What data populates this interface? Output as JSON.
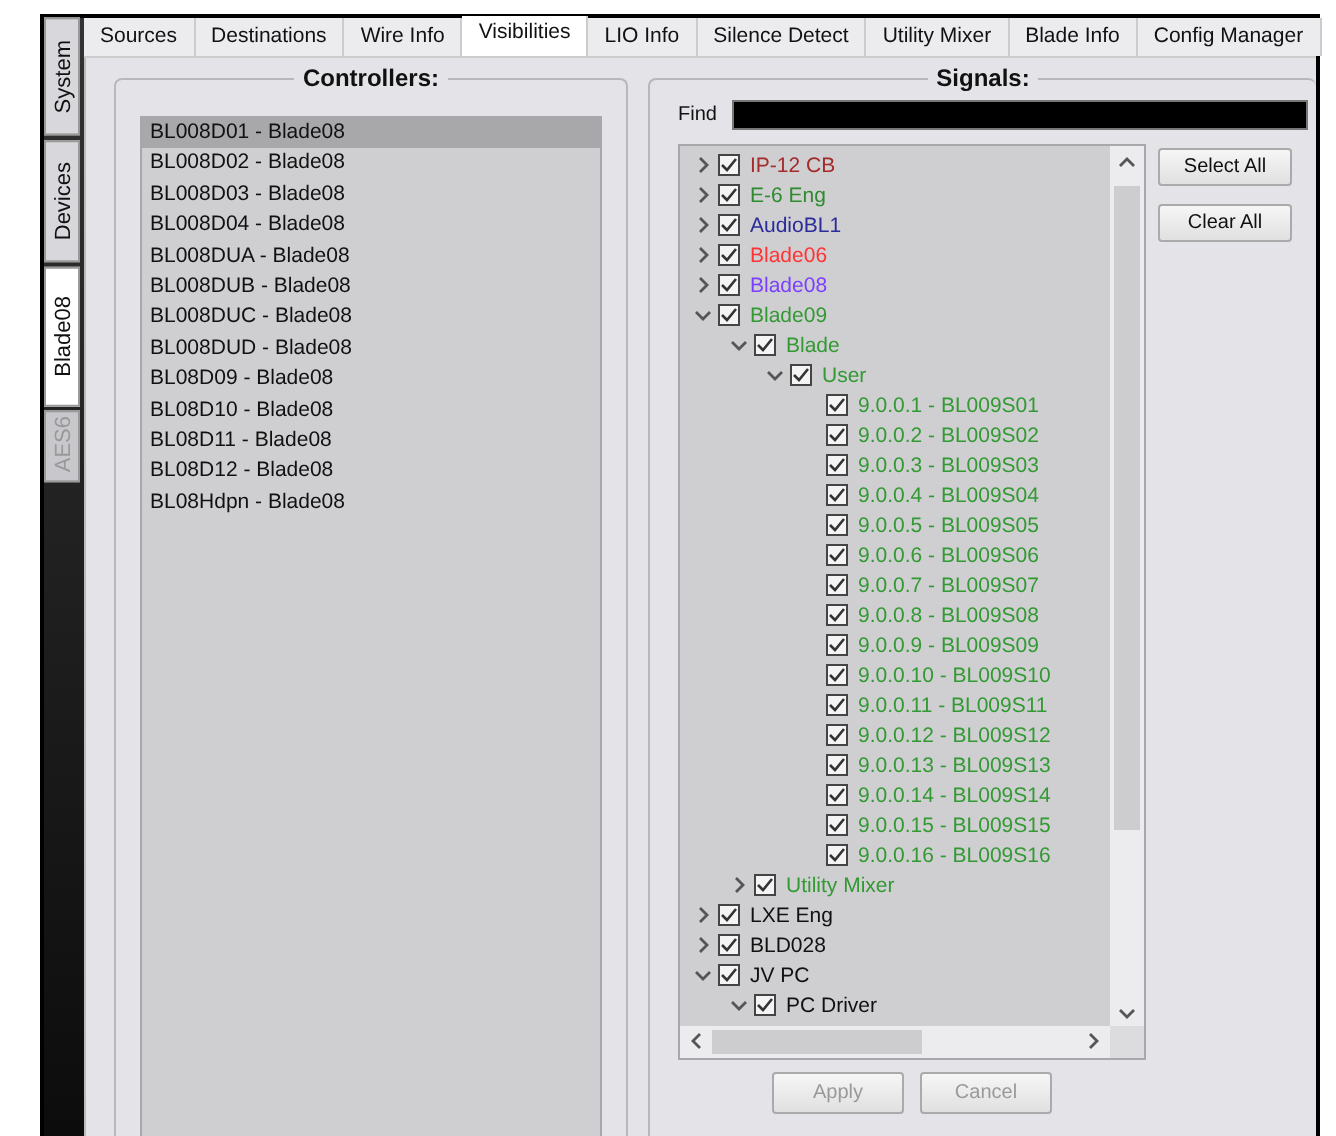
{
  "side_tabs": [
    {
      "label": "System",
      "selected": false,
      "disabled": false
    },
    {
      "label": "Devices",
      "selected": false,
      "disabled": false
    },
    {
      "label": "Blade08",
      "selected": true,
      "disabled": false
    },
    {
      "label": "AES6",
      "selected": false,
      "disabled": true
    }
  ],
  "tabs": [
    {
      "label": "Sources",
      "selected": false
    },
    {
      "label": "Destinations",
      "selected": false
    },
    {
      "label": "Wire Info",
      "selected": false
    },
    {
      "label": "Visibilities",
      "selected": true
    },
    {
      "label": "LIO Info",
      "selected": false
    },
    {
      "label": "Silence Detect",
      "selected": false
    },
    {
      "label": "Utility Mixer",
      "selected": false
    },
    {
      "label": "Blade Info",
      "selected": false
    },
    {
      "label": "Config Manager",
      "selected": false
    }
  ],
  "controllers": {
    "title": "Controllers:",
    "items": [
      {
        "label": "BL008D01 - Blade08",
        "selected": true
      },
      {
        "label": "BL008D02 - Blade08",
        "selected": false
      },
      {
        "label": "BL008D03 - Blade08",
        "selected": false
      },
      {
        "label": "BL008D04 - Blade08",
        "selected": false
      },
      {
        "label": "BL008DUA - Blade08",
        "selected": false
      },
      {
        "label": "BL008DUB - Blade08",
        "selected": false
      },
      {
        "label": "BL008DUC - Blade08",
        "selected": false
      },
      {
        "label": "BL008DUD - Blade08",
        "selected": false
      },
      {
        "label": "BL08D09 - Blade08",
        "selected": false
      },
      {
        "label": "BL08D10 - Blade08",
        "selected": false
      },
      {
        "label": "BL08D11 - Blade08",
        "selected": false
      },
      {
        "label": "BL08D12 - Blade08",
        "selected": false
      },
      {
        "label": "BL08Hdpn - Blade08",
        "selected": false
      }
    ]
  },
  "signals": {
    "title": "Signals:",
    "find_label": "Find",
    "tree": [
      {
        "label": "IP-12 CB",
        "checked": true,
        "expanded": false,
        "color": "#a52a2a"
      },
      {
        "label": "E-6 Eng",
        "checked": true,
        "expanded": false,
        "color": "#2e8b2e"
      },
      {
        "label": "AudioBL1",
        "checked": true,
        "expanded": false,
        "color": "#2a2a99"
      },
      {
        "label": "Blade06",
        "checked": true,
        "expanded": false,
        "color": "#ff3333"
      },
      {
        "label": "Blade08",
        "checked": true,
        "expanded": false,
        "color": "#7b3fff"
      },
      {
        "label": "Blade09",
        "checked": true,
        "expanded": true,
        "color": "#339933",
        "children": [
          {
            "label": "Blade",
            "checked": true,
            "expanded": true,
            "color": "#339933",
            "children": [
              {
                "label": "User",
                "checked": true,
                "expanded": true,
                "color": "#339933",
                "children": [
                  {
                    "label": "9.0.0.1 - BL009S01",
                    "checked": true,
                    "color": "#339933"
                  },
                  {
                    "label": "9.0.0.2 - BL009S02",
                    "checked": true,
                    "color": "#339933"
                  },
                  {
                    "label": "9.0.0.3 - BL009S03",
                    "checked": true,
                    "color": "#339933"
                  },
                  {
                    "label": "9.0.0.4 - BL009S04",
                    "checked": true,
                    "color": "#339933"
                  },
                  {
                    "label": "9.0.0.5 - BL009S05",
                    "checked": true,
                    "color": "#339933"
                  },
                  {
                    "label": "9.0.0.6 - BL009S06",
                    "checked": true,
                    "color": "#339933"
                  },
                  {
                    "label": "9.0.0.7 - BL009S07",
                    "checked": true,
                    "color": "#339933"
                  },
                  {
                    "label": "9.0.0.8 - BL009S08",
                    "checked": true,
                    "color": "#339933"
                  },
                  {
                    "label": "9.0.0.9 - BL009S09",
                    "checked": true,
                    "color": "#339933"
                  },
                  {
                    "label": "9.0.0.10 - BL009S10",
                    "checked": true,
                    "color": "#339933"
                  },
                  {
                    "label": "9.0.0.11 - BL009S11",
                    "checked": true,
                    "color": "#339933"
                  },
                  {
                    "label": "9.0.0.12 - BL009S12",
                    "checked": true,
                    "color": "#339933"
                  },
                  {
                    "label": "9.0.0.13 - BL009S13",
                    "checked": true,
                    "color": "#339933"
                  },
                  {
                    "label": "9.0.0.14 - BL009S14",
                    "checked": true,
                    "color": "#339933"
                  },
                  {
                    "label": "9.0.0.15 - BL009S15",
                    "checked": true,
                    "color": "#339933"
                  },
                  {
                    "label": "9.0.0.16 - BL009S16",
                    "checked": true,
                    "color": "#339933"
                  }
                ]
              }
            ]
          },
          {
            "label": "Utility Mixer",
            "checked": true,
            "expanded": false,
            "color": "#339933"
          }
        ]
      },
      {
        "label": "LXE Eng",
        "checked": true,
        "expanded": false,
        "color": "#111111"
      },
      {
        "label": "BLD028",
        "checked": true,
        "expanded": false,
        "color": "#111111"
      },
      {
        "label": "JV PC",
        "checked": true,
        "expanded": true,
        "color": "#111111",
        "children": [
          {
            "label": "PC Driver",
            "checked": true,
            "expanded": true,
            "color": "#111111"
          }
        ]
      }
    ],
    "side_buttons": [
      "Select All",
      "Clear All"
    ]
  },
  "buttons": [
    {
      "label": "Apply",
      "disabled": true
    },
    {
      "label": "Cancel",
      "disabled": true
    }
  ]
}
